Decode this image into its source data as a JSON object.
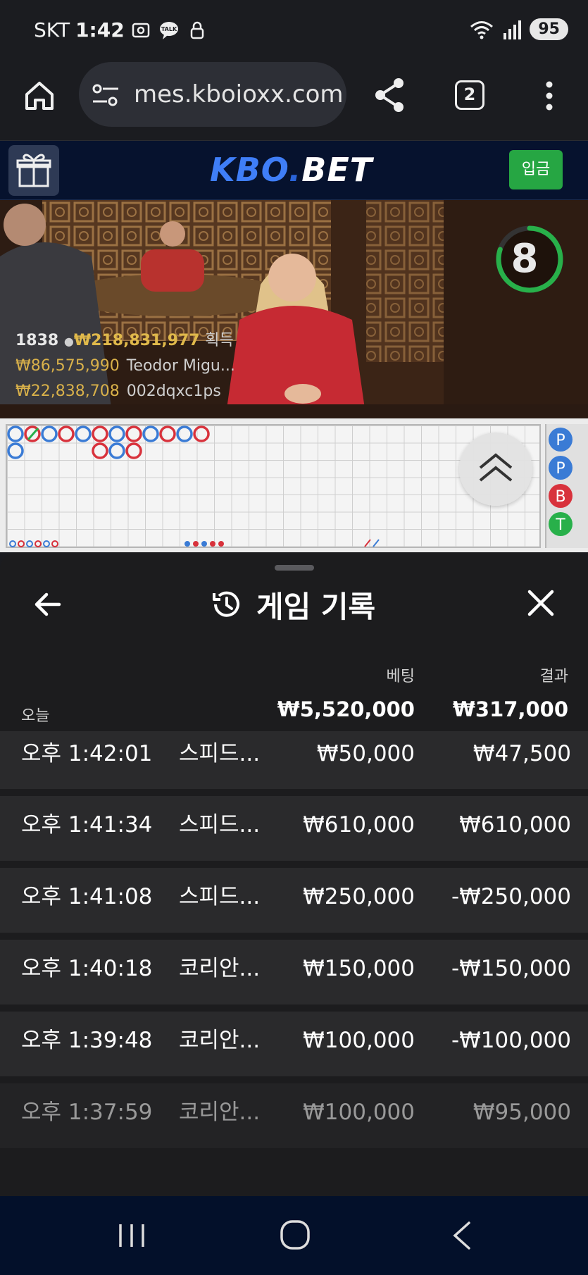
{
  "status_bar": {
    "carrier": "SKT",
    "time": "1:42",
    "battery": "95",
    "icons": [
      "screenshot-icon",
      "talk-icon",
      "lock-app-icon",
      "wifi-icon",
      "signal-icon"
    ]
  },
  "browser": {
    "url": "mes.kboioxx.com",
    "tab_count": "2"
  },
  "site": {
    "logo_main": "KBO",
    "logo_dot": ".",
    "logo_bet": "BET",
    "deposit_label": "입금"
  },
  "video": {
    "countdown": "8",
    "countdown_fraction": 0.8,
    "winners_count": "1838",
    "winners_total": "₩218,831,977",
    "winners_label": "획득",
    "winners": [
      {
        "amount": "₩86,575,990",
        "name": "Teodor Migu..."
      },
      {
        "amount": "₩22,838,708",
        "name": "002dqxc1ps"
      }
    ]
  },
  "sheet": {
    "title": "게임 기록",
    "col_bet": "베팅",
    "col_result": "결과",
    "today_label": "오늘",
    "today_bet": "₩5,520,000",
    "today_result": "₩317,000",
    "rows": [
      {
        "time": "오후 1:42:01",
        "game": "스피드...",
        "bet": "₩50,000",
        "result": "₩47,500"
      },
      {
        "time": "오후 1:41:34",
        "game": "스피드...",
        "bet": "₩610,000",
        "result": "₩610,000"
      },
      {
        "time": "오후 1:41:08",
        "game": "스피드...",
        "bet": "₩250,000",
        "result": "-₩250,000"
      },
      {
        "time": "오후 1:40:18",
        "game": "코리안...",
        "bet": "₩150,000",
        "result": "-₩150,000"
      },
      {
        "time": "오후 1:39:48",
        "game": "코리안...",
        "bet": "₩100,000",
        "result": "-₩100,000"
      },
      {
        "time": "오후 1:37:59",
        "game": "코리안...",
        "bet": "₩100,000",
        "result": "₩95,000"
      }
    ]
  },
  "colors": {
    "sheet_bg": "#1c1c1e",
    "row_bg": "#2a2a2c",
    "accent_green": "#26a643",
    "logo_blue": "#3f7ef7",
    "banker_red": "#d8323c",
    "player_blue": "#3a7bd5"
  }
}
